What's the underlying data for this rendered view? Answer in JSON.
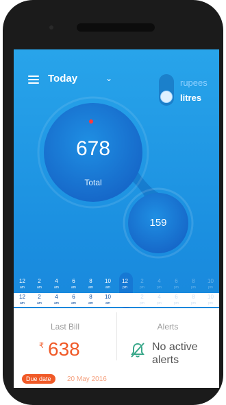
{
  "header": {
    "menu_icon": "menu-icon",
    "title": "Today",
    "dropdown_icon": "chevron-down-icon"
  },
  "units": {
    "option_a": "rupees",
    "option_b": "litres",
    "selected": "litres"
  },
  "usage": {
    "total_value": "678",
    "total_label": "Total",
    "secondary_value": "159"
  },
  "timeline": {
    "ticks": [
      {
        "t": "12",
        "s": "am"
      },
      {
        "t": "2",
        "s": "am"
      },
      {
        "t": "4",
        "s": "am"
      },
      {
        "t": "6",
        "s": "am"
      },
      {
        "t": "8",
        "s": "am"
      },
      {
        "t": "10",
        "s": "am"
      },
      {
        "t": "12",
        "s": "pm"
      },
      {
        "t": "2",
        "s": "pm"
      },
      {
        "t": "4",
        "s": "pm"
      },
      {
        "t": "6",
        "s": "pm"
      },
      {
        "t": "8",
        "s": "pm"
      },
      {
        "t": "10",
        "s": "pm"
      }
    ],
    "selected_index_top": 6,
    "selected_index_bottom": 6
  },
  "bill": {
    "label": "Last Bill",
    "currency": "₹",
    "amount": "638",
    "due_badge": "Due date",
    "due_date": "20 May 2016"
  },
  "alerts": {
    "label": "Alerts",
    "icon": "bell-off-icon",
    "line1": "No active",
    "line2": "alerts"
  },
  "colors": {
    "accent": "#28a4ea",
    "bill_orange": "#f05a28",
    "alert_icon": "#3aa88a"
  }
}
